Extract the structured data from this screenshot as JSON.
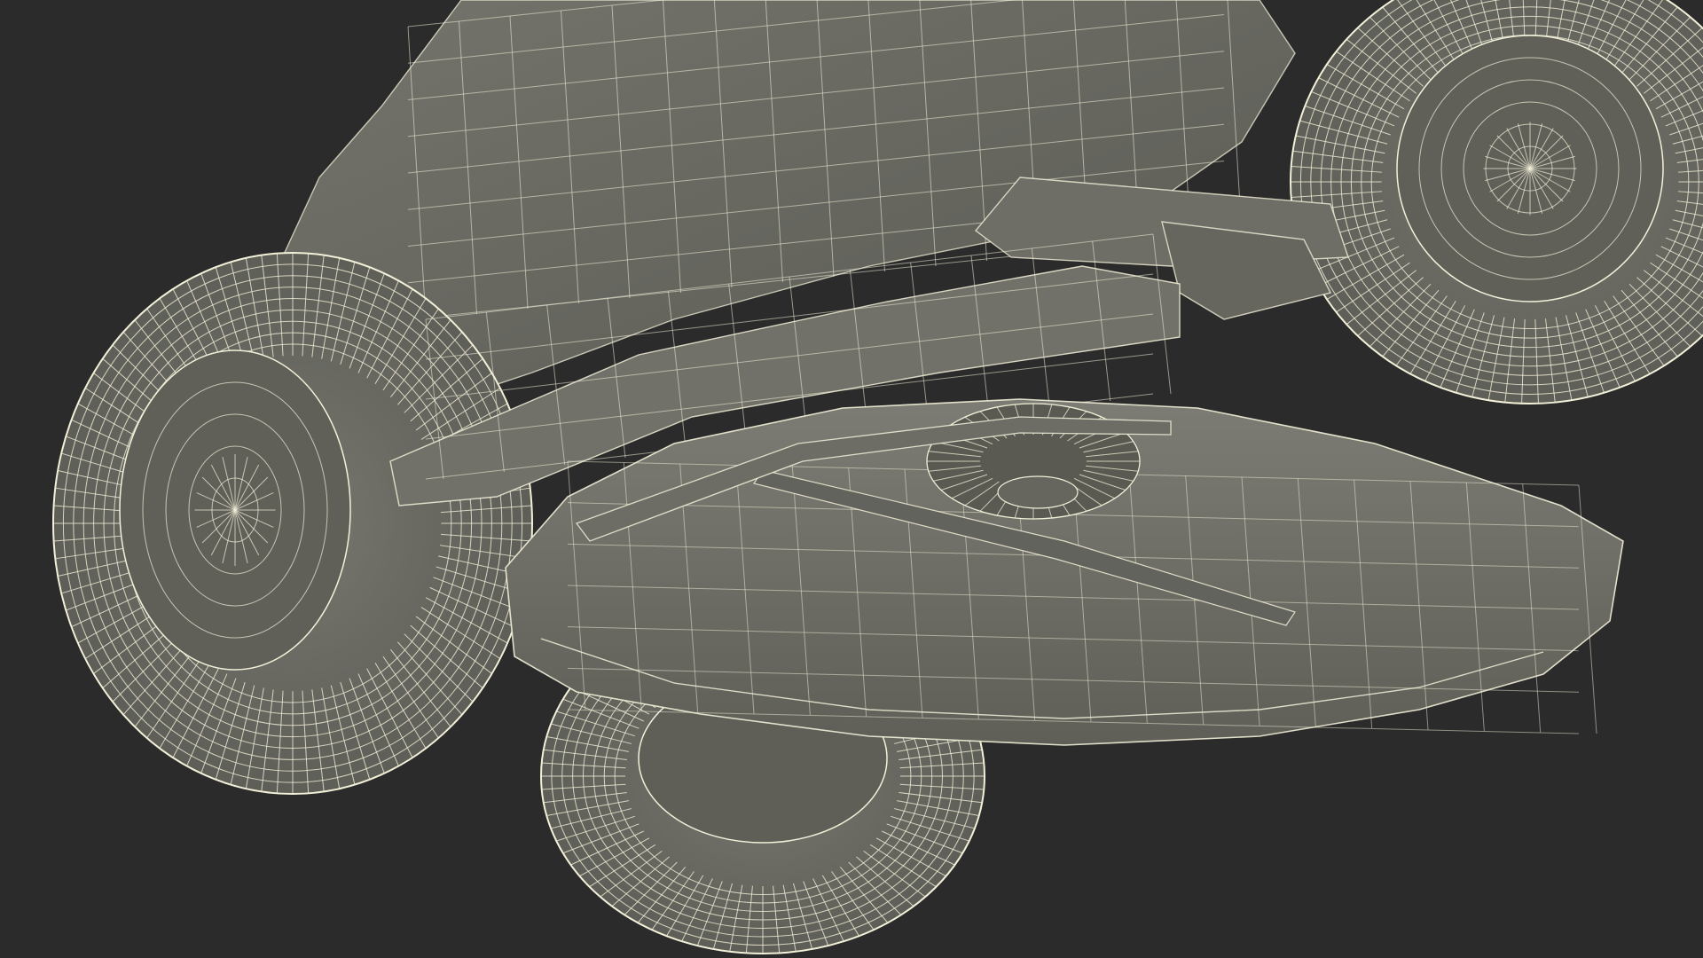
{
  "scene": {
    "subject": "wireframe-riding-lawn-mower-underside",
    "colors": {
      "background": "#2b2b2b",
      "body_fill": "#6b6b64",
      "body_shadow": "#55554f",
      "deck_fill": "#74746c",
      "tire_fill": "#6e6e67",
      "hub_fill": "#606059",
      "wire": "#f2f0d8"
    }
  }
}
